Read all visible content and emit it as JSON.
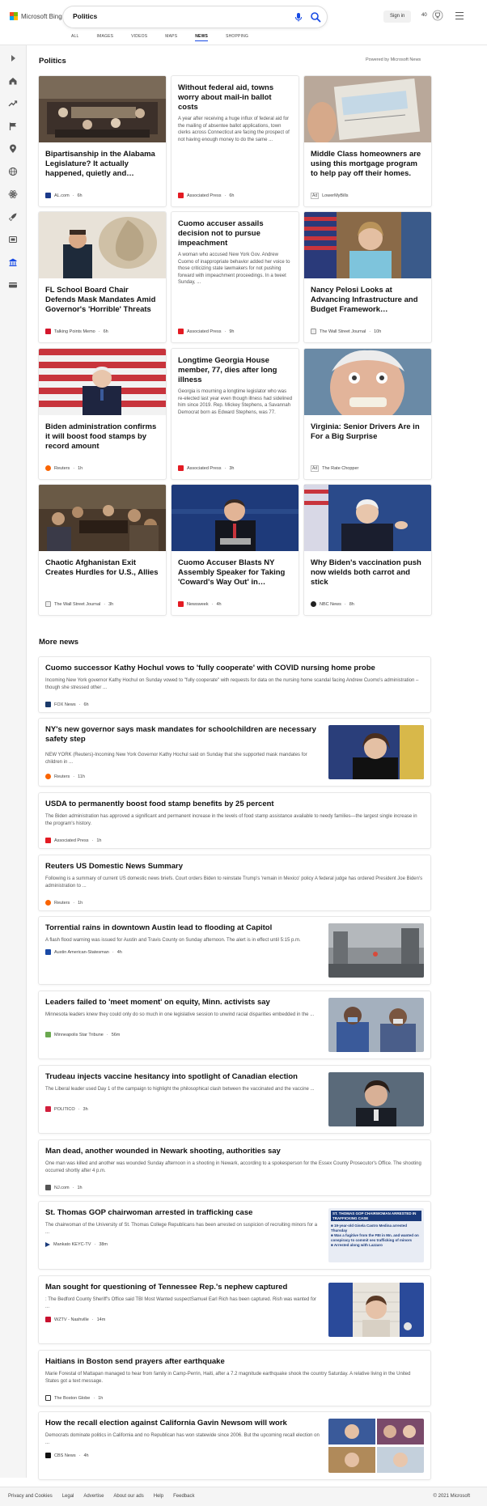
{
  "header": {
    "logo_text": "Microsoft Bing",
    "search_value": "Politics",
    "signin_label": "Sign in",
    "points": "40",
    "tabs": [
      {
        "label": "ALL"
      },
      {
        "label": "IMAGES"
      },
      {
        "label": "VIDEOS"
      },
      {
        "label": "MAPS"
      },
      {
        "label": "NEWS"
      },
      {
        "label": "SHOPPING"
      }
    ],
    "active_tab": "NEWS"
  },
  "sidebar": {
    "icons": [
      "expand-icon",
      "home-icon",
      "trending-icon",
      "flag-icon",
      "location-icon",
      "globe-icon",
      "science-icon",
      "rocket-icon",
      "entertainment-icon",
      "sports-icon",
      "money-icon"
    ]
  },
  "section": {
    "title": "Politics",
    "powered_by": "Powered by Microsoft News"
  },
  "cards": [
    {
      "title": "Bipartisanship in the Alabama Legislature? It actually happened, quietly and…",
      "source": "AL.com",
      "time": "6h",
      "ad": false,
      "snippet": ""
    },
    {
      "title": "Without federal aid, towns worry about mail-in ballot costs",
      "source": "Associated Press",
      "time": "6h",
      "ad": false,
      "snippet": "A year after receiving a huge influx of federal aid for the mailing of absentee ballot applications, town clerks across Connecticut are facing the prospect of not having enough money to do the same ..."
    },
    {
      "title": "Middle Class homeowners are using this mortgage program to help pay off their homes. Don'…",
      "source": "LowerMyBills",
      "time": "",
      "ad": true,
      "snippet": ""
    },
    {
      "title": "FL School Board Chair Defends Mask Mandates Amid Governor's 'Horrible' Threats",
      "source": "Talking Points Memo",
      "time": "6h",
      "ad": false,
      "snippet": ""
    },
    {
      "title": "Cuomo accuser assails decision not to pursue impeachment",
      "source": "Associated Press",
      "time": "9h",
      "ad": false,
      "snippet": "A woman who accused New York Gov. Andrew Cuomo of inappropriate behavior added her voice to those criticizing state lawmakers for not pushing forward with impeachment proceedings. In a tweet Sunday, ..."
    },
    {
      "title": "Nancy Pelosi Looks at Advancing Infrastructure and Budget Framework…",
      "source": "The Wall Street Journal",
      "time": "10h",
      "ad": false,
      "snippet": ""
    },
    {
      "title": "Biden administration confirms it will boost food stamps by record amount",
      "source": "Reuters",
      "time": "1h",
      "ad": false,
      "snippet": ""
    },
    {
      "title": "Longtime Georgia House member, 77, dies after long illness",
      "source": "Associated Press",
      "time": "3h",
      "ad": false,
      "snippet": "Georgia is mourning a longtime legislator who was re-elected last year even though illness had sidelined him since 2019. Rep. Mickey Stephens, a Savannah Democrat born as Edward Stephens, was 77."
    },
    {
      "title": "Virginia: Senior Drivers Are in For a Big Surprise",
      "source": "The Rate Chopper",
      "time": "",
      "ad": true,
      "snippet": ""
    },
    {
      "title": "Chaotic Afghanistan Exit Creates Hurdles for U.S., Allies",
      "source": "The Wall Street Journal",
      "time": "3h",
      "ad": false,
      "snippet": ""
    },
    {
      "title": "Cuomo Accuser Blasts NY Assembly Speaker for Taking 'Coward's Way Out' in…",
      "source": "Newsweek",
      "time": "4h",
      "ad": false,
      "snippet": ""
    },
    {
      "title": "Why Biden's vaccination push now wields both carrot and stick",
      "source": "NBC News",
      "time": "8h",
      "ad": false,
      "snippet": ""
    }
  ],
  "more_news": {
    "title": "More news",
    "items": [
      {
        "title": "Cuomo successor Kathy Hochul vows to 'fully cooperate' with COVID nursing home probe",
        "snippet": "Incoming New York governor Kathy Hochul on Sunday vowed to \"fully cooperate\" with requests for data on the nursing home scandal facing Andrew Cuomo's administration – though she stressed other ...",
        "source": "FOX News",
        "time": "6h"
      },
      {
        "title": "NY's new governor says mask mandates for schoolchildren are necessary safety step",
        "snippet": "NEW YORK (Reuters)-Incoming New York Governor Kathy Hochul said on Sunday that she supported mask mandates for children in ...",
        "source": "Reuters",
        "time": "11h"
      },
      {
        "title": "USDA to permanently boost food stamp benefits by 25 percent",
        "snippet": "The Biden administration has approved a significant and permanent increase in the levels of food stamp assistance available to needy families—the largest single increase in the program's history.",
        "source": "Associated Press",
        "time": "1h"
      },
      {
        "title": "Reuters US Domestic News Summary",
        "snippet": "Following is a summary of current US domestic news briefs. Court orders Biden to reinstate Trump's 'remain in Mexico' policy A federal judge has ordered President Joe Biden's administration to ...",
        "source": "Reuters",
        "time": "1h"
      },
      {
        "title": "Torrential rains in downtown Austin lead to flooding at Capitol",
        "snippet": "A flash flood warning was issued for Austin and Travis County on Sunday afternoon. The alert is in effect until 5:15 p.m.",
        "source": "Austin American-Statesman",
        "time": "4h"
      },
      {
        "title": "Leaders failed to 'meet moment' on equity, Minn. activists say",
        "snippet": "Minnesota leaders knew they could only do so much in one legislative session to unwind racial disparities embedded in the ...",
        "source": "Minneapolis Star Tribune",
        "time": "56m"
      },
      {
        "title": "Trudeau injects vaccine hesitancy into spotlight of Canadian election",
        "snippet": "The Liberal leader used Day 1 of the campaign to highlight the philosophical clash between the vaccinated and the vaccine ...",
        "source": "POLITICO",
        "time": "3h"
      },
      {
        "title": "Man dead, another wounded in Newark shooting, authorities say",
        "snippet": "One man was killed and another was wounded Sunday afternoon in a shooting in Newark, according to a spokesperson for the Essex County Prosecutor's Office. The shooting occurred shortly after 4 p.m.",
        "source": "NJ.com",
        "time": "1h"
      },
      {
        "title": "St. Thomas GOP chairwoman arrested in trafficking case",
        "snippet": "The chairwoman of the University of St. Thomas College Republicans has been arrested on suspicion of recruiting minors for a ...",
        "source": "Mankato KEYC-TV",
        "time": "38m"
      },
      {
        "title": "Man sought for questioning of Tennessee Rep.'s nephew captured",
        "snippet": ": The Bedford County Sheriff's Office said TBI Most Wanted suspectSamuel Earl Rich has been captured. Rish was wanted for ...",
        "source": "WZTV - Nashville",
        "time": "14m"
      },
      {
        "title": "Haitians in Boston send prayers after earthquake",
        "snippet": "Marie Forestal of Mattapan managed to hear from family in Camp-Perrin, Haiti, after a 7.2 magnitude earthquake shook the country Saturday. A relative living in the United States got a text message.",
        "source": "The Boston Globe",
        "time": "1h"
      },
      {
        "title": "How the recall election against California Gavin Newsom will work",
        "snippet": "Democrats dominate politics in California and no Republican has won statewide since 2006. But the upcoming recall election on ...",
        "source": "CBS News",
        "time": "4h"
      }
    ],
    "thumb_text": {
      "trafficking_header": "ST. THOMAS GOP CHAIRWOMAN ARRESTED IN TRAFFICKING CASE",
      "trafficking_lines": [
        "19-year-old Gisela Castro Medina arrested Thursday",
        "Was a fugitive from the FBI in Mn. and wanted on conspiracy to commit sex trafficking of minors",
        "Arrested along with Lazzaro"
      ]
    }
  },
  "footer": {
    "links": [
      "Privacy and Cookies",
      "Legal",
      "Advertise",
      "About our ads",
      "Help",
      "Feedback"
    ],
    "copyright": "© 2021 Microsoft"
  }
}
